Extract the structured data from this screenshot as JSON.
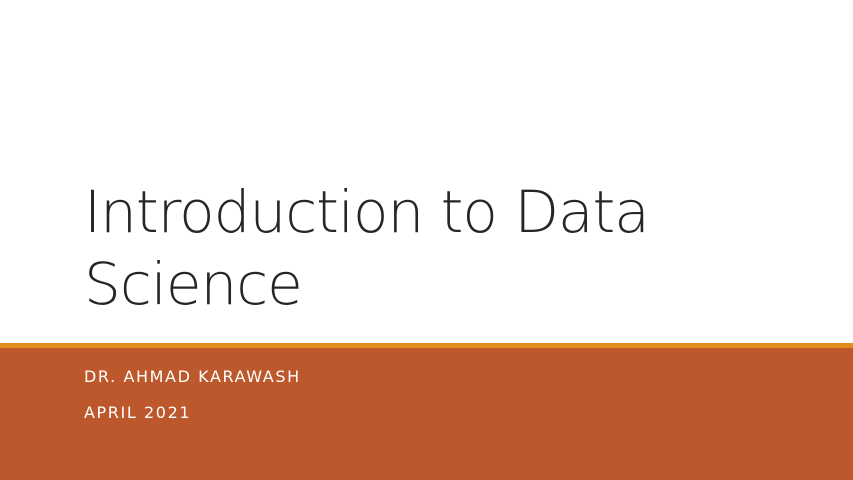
{
  "slide": {
    "title_line1": "Introduction to Data",
    "title_line2": "Science",
    "author": "DR. AHMAD KARAWASH",
    "date": "APRIL 2021"
  },
  "colors": {
    "background": "#ffffff",
    "title_text": "#262626",
    "accent_line": "#e08d1c",
    "footer_band": "#bd582c",
    "subtitle_text": "#ffffff"
  }
}
